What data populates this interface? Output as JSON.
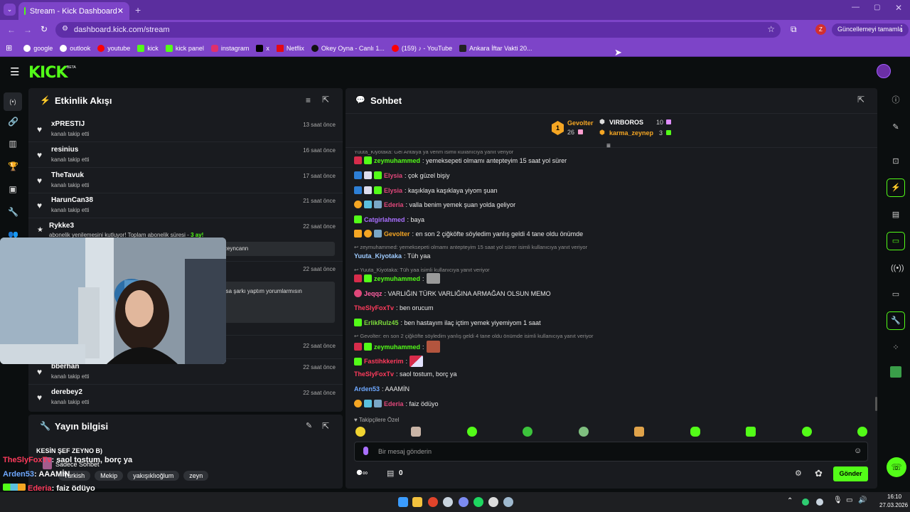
{
  "browser": {
    "tab_title": "Stream - Kick Dashboard",
    "url": "dashboard.kick.com/stream",
    "profile_initial": "Z",
    "update_label": "Güncellemeyi tamamla",
    "bookmarks": [
      {
        "label": "google",
        "color": "#ffffff"
      },
      {
        "label": "outlook",
        "color": "#ffffff"
      },
      {
        "label": "youtube",
        "color": "#ff0000"
      },
      {
        "label": "kick",
        "color": "#53fc18"
      },
      {
        "label": "kick panel",
        "color": "#53fc18"
      },
      {
        "label": "instagram",
        "color": "#e1306c"
      },
      {
        "label": "x",
        "color": "#000000"
      },
      {
        "label": "Netflix",
        "color": "#e50914"
      },
      {
        "label": "Okey Oyna - Canlı 1...",
        "color": "#111111"
      },
      {
        "label": "(159) ♪ - YouTube",
        "color": "#ff0000"
      },
      {
        "label": "Ankara İftar Vakti 20...",
        "color": "#222222"
      }
    ]
  },
  "kick": {
    "logo": "KICK",
    "beta": "BETA",
    "accent": "#53fc18"
  },
  "activity": {
    "title": "Etkinlik Akışı",
    "items": [
      {
        "name": "xPRESTIJ",
        "sub": "kanalı takip etti",
        "time": "13 saat önce"
      },
      {
        "name": "resinius",
        "sub": "kanalı takip etti",
        "time": "16 saat önce"
      },
      {
        "name": "TheTavuk",
        "sub": "kanalı takip etti",
        "time": "17 saat önce"
      },
      {
        "name": "HarunCan38",
        "sub": "kanalı takip etti",
        "time": "21 saat önce"
      }
    ],
    "sub_item": {
      "name": "Rykke3",
      "text": "abonelik yenilemesini kutluyor! Toplam abonelik süresi -",
      "months": "3 ay!",
      "time": "22 saat önce",
      "msg": "zeyncann"
    },
    "hidden_item": {
      "time": "22 saat önce",
      "msg": "rsa şarkı yaptım yorumlarmısın"
    },
    "hidden_item2_time": "22 saat önce",
    "tail_items": [
      {
        "name": "bberhan",
        "sub": "kanalı takip etti",
        "time": "22 saat önce"
      },
      {
        "name": "derebey2",
        "sub": "kanalı takip etti",
        "time": "22 saat önce"
      }
    ]
  },
  "stream_info": {
    "title": "Yayın bilgisi",
    "stream_title": "KESİN ŞEF ZEYNO B)",
    "category": "Sadece Sohbet",
    "tags": [
      "Turkish",
      "Mekip",
      "yakışıklıoğlum",
      "zeyn"
    ]
  },
  "overlay_chat": [
    {
      "user": "TheSlyFoxTv",
      "color": "#ff3b5c",
      "text": ": saol tostum, borç ya"
    },
    {
      "user": "Arden53",
      "color": "#6ea8ff",
      "text": ": AAAMİN"
    },
    {
      "user": "Ederia",
      "color": "#ff3b5c",
      "text": ": faiz ödüyo"
    }
  ],
  "chat": {
    "title": "Sohbet",
    "leaderboard": [
      {
        "rank": "1",
        "user": "Gevolter",
        "count": "26",
        "color": "#f5a623"
      },
      {
        "user": "VIRBOROS",
        "count": "10",
        "color": "#ffffff"
      },
      {
        "user": "karma_zeynep",
        "count": "3",
        "color": "#f5a623"
      }
    ],
    "partial_top": "Yuuta_Kiyotaka: Gel Antalya ya venm isimli kullanıcıya yanıt veriyor",
    "messages": [
      {
        "user": "zeymuhammed",
        "color": "#53fc18",
        "text": ": yemeksepeti olmamı antepteyim 15 saat yol sürer"
      },
      {
        "user": "Elysia",
        "color": "#e0477a",
        "text": ": çok güzel bişiy"
      },
      {
        "user": "Elysia",
        "color": "#e0477a",
        "text": ": kaşıklaya kaşıklaya yiyom şuan"
      },
      {
        "user": "Ederia",
        "color": "#e0477a",
        "text": ": valla benim yemek şuan yolda geliyor"
      },
      {
        "user": "Catgirlahmed",
        "color": "#a970ff",
        "text": ": baya"
      },
      {
        "user": "Gevolter",
        "color": "#f5a623",
        "text": ": en son 2 çiğköfte söyledim yanlış geldi 4 tane oldu önümde"
      },
      {
        "reply": "zeymuhammed: yemeksepeti olmamı antepteyim 15 saat yol sürer isimli kullanıcıya yanıt veriyor"
      },
      {
        "user": "Yuuta_Kiyotaka",
        "color": "#9ecbff",
        "text": ": Tüh yaa"
      },
      {
        "reply": "Yuuta_Kiyotaka: Tüh yaa isimli kullanıcıya yanıt veriyor"
      },
      {
        "user": "zeymuhammed",
        "color": "#53fc18",
        "text": ":"
      },
      {
        "user": "Jeqqz",
        "color": "#ff5fa2",
        "text": ": VARLIĞIN TÜRK VARLIĞINA ARMAĞAN OLSUN MEMO"
      },
      {
        "user": "TheSlyFoxTv",
        "color": "#ff3b5c",
        "text": ": ben orucum"
      },
      {
        "user": "ErlikRulz45",
        "color": "#7ddc3c",
        "text": ": ben hastayım ilaç içtim yemek yiyemiyom 1 saat"
      },
      {
        "reply": "Gevolter: en son 2 çiğköfte söyledim yanlış geldi 4 tane oldu önümde isimli kullanıcıya yanıt veriyor"
      },
      {
        "user": "zeymuhammed",
        "color": "#53fc18",
        "text": ":"
      },
      {
        "user": "Fastihkkerim",
        "color": "#ff3b5c",
        "text": ":"
      },
      {
        "user": "TheSlyFoxTv",
        "color": "#ff3b5c",
        "text": ": saol tostum, borç ya"
      },
      {
        "user": "Arden53",
        "color": "#6ea8ff",
        "text": ": AAAMİN"
      },
      {
        "user": "Ederia",
        "color": "#e0477a",
        "text": ": faiz ödüyo"
      }
    ],
    "followers_only": "Takipçilere Özel",
    "input_placeholder": "Bir mesaj gönderin",
    "send_label": "Gönder",
    "points": "0"
  },
  "taskbar": {
    "time": "16:10",
    "date": "27.03.2026"
  }
}
